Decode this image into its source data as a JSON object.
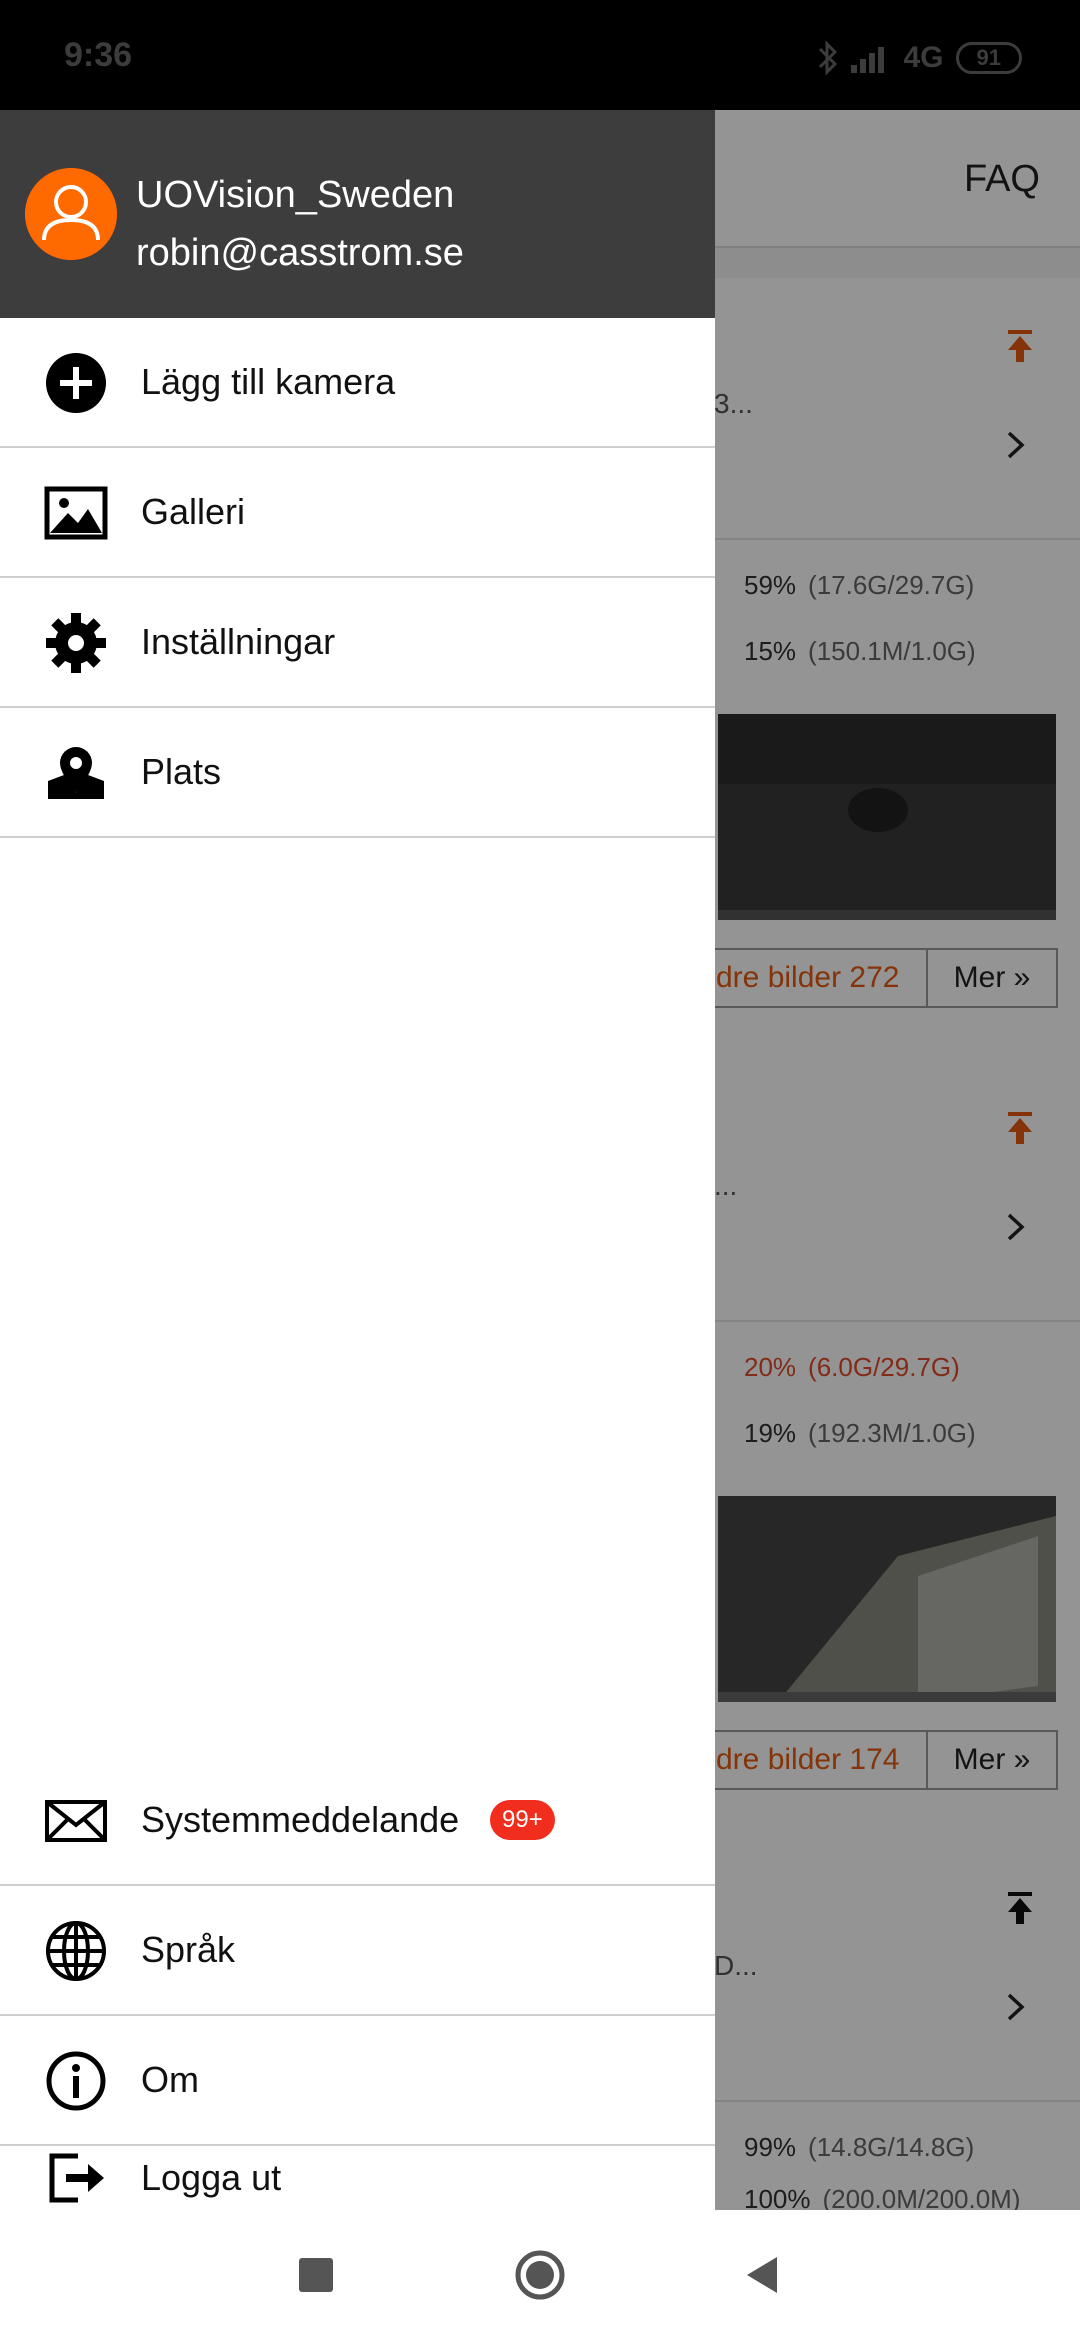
{
  "status_bar": {
    "time": "9:36",
    "network": "4G",
    "battery": "91"
  },
  "background": {
    "faq_label": "FAQ",
    "cards": [
      {
        "ellipsis": "3...",
        "sd_percent": "59%",
        "sd_size": "(17.6G/29.7G)",
        "data_percent": "15%",
        "data_size": "(150.1M/1.0G)",
        "more_images": "dre bilder 272",
        "more_button": "Mer »"
      },
      {
        "ellipsis": "...",
        "sd_percent": "20%",
        "sd_size": "(6.0G/29.7G)",
        "data_percent": "19%",
        "data_size": "(192.3M/1.0G)",
        "more_images": "dre bilder 174",
        "more_button": "Mer »"
      },
      {
        "ellipsis": "D...",
        "sd_percent": "99%",
        "sd_size": "(14.8G/14.8G)",
        "data_percent": "100%",
        "data_size": "(200.0M/200.0M)"
      }
    ]
  },
  "drawer": {
    "username": "UOVision_Sweden",
    "email": "robin@casstrom.se",
    "top_items": [
      {
        "label": "Lägg till kamera",
        "icon": "add-circle-icon"
      },
      {
        "label": "Galleri",
        "icon": "image-icon"
      },
      {
        "label": "Inställningar",
        "icon": "gear-icon"
      },
      {
        "label": "Plats",
        "icon": "map-pin-icon"
      }
    ],
    "bottom_items": [
      {
        "label": "Systemmeddelande",
        "icon": "mail-icon",
        "badge": "99+"
      },
      {
        "label": "Språk",
        "icon": "globe-icon"
      },
      {
        "label": "Om",
        "icon": "info-icon"
      },
      {
        "label": "Logga ut",
        "icon": "logout-icon"
      }
    ]
  },
  "colors": {
    "accent": "#ff6a00",
    "header": "#3d3d3d",
    "badge": "#f12d1d"
  }
}
